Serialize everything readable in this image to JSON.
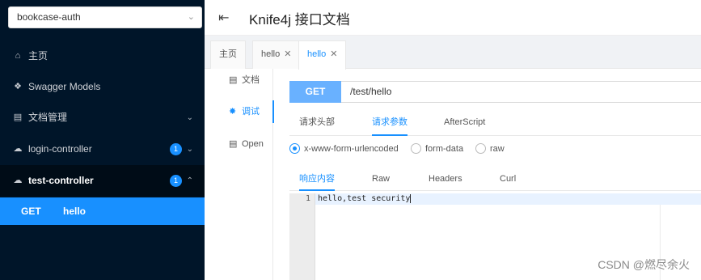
{
  "sidebar": {
    "group_select": "bookcase-auth",
    "items": [
      {
        "label": "主页"
      },
      {
        "label": "Swagger Models"
      },
      {
        "label": "文档管理"
      },
      {
        "label": "login-controller",
        "badge": "1"
      },
      {
        "label": "test-controller",
        "badge": "1"
      }
    ],
    "active_sub": {
      "method": "GET",
      "label": "hello"
    }
  },
  "header": {
    "title": "Knife4j 接口文档"
  },
  "tabs": [
    {
      "label": "主页"
    },
    {
      "label": "hello"
    },
    {
      "label": "hello"
    }
  ],
  "docnav": [
    {
      "label": "文档"
    },
    {
      "label": "调试"
    },
    {
      "label": "Open"
    }
  ],
  "request": {
    "method": "GET",
    "url": "/test/hello"
  },
  "param_tabs": [
    "请求头部",
    "请求参数",
    "AfterScript"
  ],
  "body_types": [
    "x-www-form-urlencoded",
    "form-data",
    "raw"
  ],
  "response_tabs": [
    "响应内容",
    "Raw",
    "Headers",
    "Curl"
  ],
  "response": {
    "line_number": "1",
    "content": "hello,test security"
  },
  "watermark": "CSDN @燃尽余火",
  "colors": {
    "accent": "#1890ff",
    "sidebar": "#001529"
  }
}
